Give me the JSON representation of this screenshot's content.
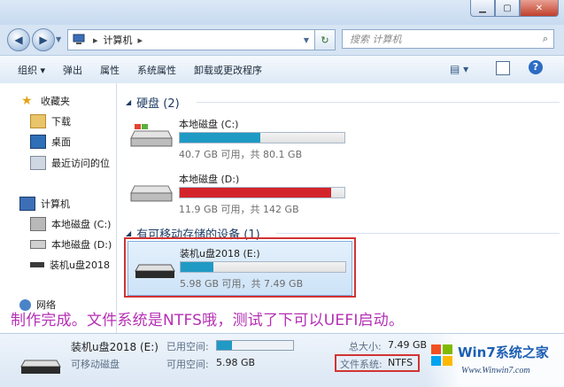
{
  "window": {
    "minimize_icon": "minimize-icon",
    "maximize_icon": "maximize-icon",
    "close_icon": "close-icon"
  },
  "address": {
    "path_root": "计算机",
    "search_placeholder": "搜索 计算机"
  },
  "toolbar": {
    "organize": "组织 ▾",
    "eject": "弹出",
    "properties": "属性",
    "system_properties": "系统属性",
    "uninstall": "卸载或更改程序"
  },
  "nav": {
    "favorites": "收藏夹",
    "downloads": "下载",
    "desktop": "桌面",
    "recent": "最近访问的位",
    "computer": "计算机",
    "drive_c": "本地磁盘 (C:)",
    "drive_d": "本地磁盘 (D:)",
    "usb": "装机u盘2018",
    "network": "网络"
  },
  "groups": {
    "hdd_header": "硬盘 (2)",
    "removable_header": "有可移动存储的设备 (1)"
  },
  "drives": [
    {
      "name": "本地磁盘 (C:)",
      "info": "40.7 GB 可用，共 80.1 GB",
      "fill": 0.49,
      "color": "#1f9ac4"
    },
    {
      "name": "本地磁盘 (D:)",
      "info": "11.9 GB 可用，共 142 GB",
      "fill": 0.92,
      "color": "#d3242c"
    },
    {
      "name": "装机u盘2018 (E:)",
      "info": "5.98 GB 可用，共 7.49 GB",
      "fill": 0.2,
      "color": "#1f9ac4"
    }
  ],
  "overlay": "制作完成。文件系统是NTFS哦，测试了下可以UEFI启动。",
  "details": {
    "name": "装机u盘2018 (E:)",
    "type": "可移动磁盘",
    "used_label": "已用空间:",
    "free_label": "可用空间:",
    "free_value": "5.98 GB",
    "total_label": "总大小:",
    "total_value": "7.49 GB",
    "fs_label": "文件系统:",
    "fs_value": "NTFS",
    "used_fill": 0.2
  },
  "watermark": {
    "brand": "Win7系统之家",
    "url": "Www.Winwin7.com"
  }
}
